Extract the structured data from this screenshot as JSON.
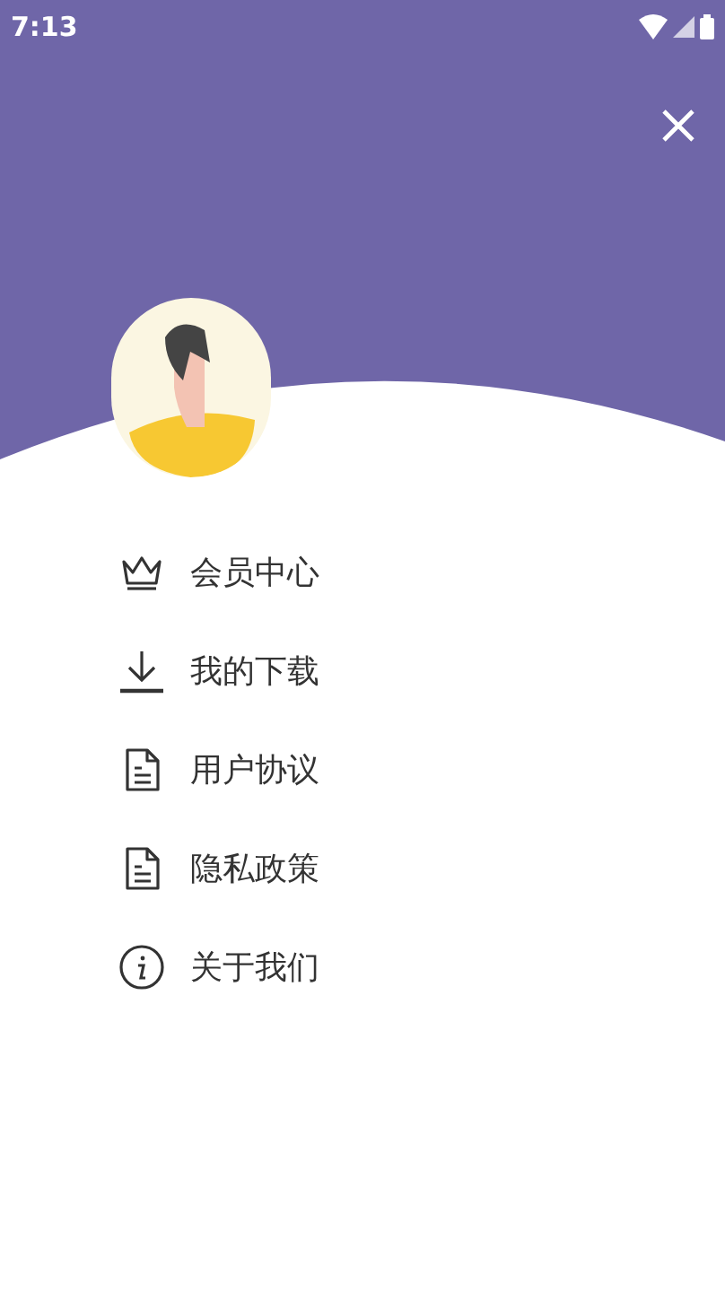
{
  "status_bar": {
    "time": "7:13"
  },
  "menu": [
    {
      "kind": "crown",
      "label": "会员中心"
    },
    {
      "kind": "download",
      "label": "我的下载"
    },
    {
      "kind": "document",
      "label": "用户协议"
    },
    {
      "kind": "document",
      "label": "隐私政策"
    },
    {
      "kind": "info",
      "label": "关于我们"
    }
  ]
}
